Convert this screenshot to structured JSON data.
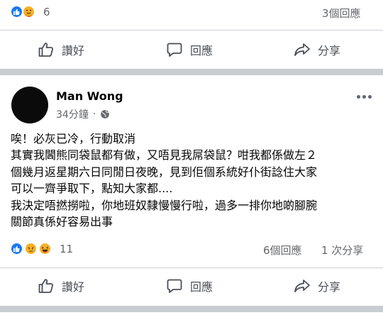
{
  "top_post": {
    "reaction_count": "6",
    "comments": "3個回應"
  },
  "actions": {
    "like": "讚好",
    "comment": "回應",
    "share": "分享"
  },
  "post": {
    "author": "Man Wong",
    "time": "34分鐘",
    "time_separator": "·",
    "lines": [
      "唉！必灰已冷，行動取消",
      "其實我閪熊同袋鼠都有做，又唔見我屌袋鼠？咁我都係做左２",
      "個幾月返星期六日同閒日夜晚，見到佢個系統好仆街諗住大家",
      "可以一齊爭取下，點知大家都....",
      "我決定唔撚撈啦，你地班奴隸慢慢行啦，過多一排你地啲腳腕",
      "關節真係好容易出事"
    ],
    "reaction_count": "11",
    "comments": "6個回應",
    "shares": "1 次分享"
  },
  "colors": {
    "like_blue": "#1877f2",
    "haha_yellow": "#f7b125",
    "text_gray": "#65676b",
    "separator": "#c9ccd1"
  },
  "icons": [
    "like-reaction-icon",
    "care-reaction-icon",
    "sad-reaction-icon",
    "haha-reaction-icon",
    "thumbs-up-icon",
    "comment-icon",
    "share-icon",
    "globe-icon",
    "more-icon"
  ]
}
